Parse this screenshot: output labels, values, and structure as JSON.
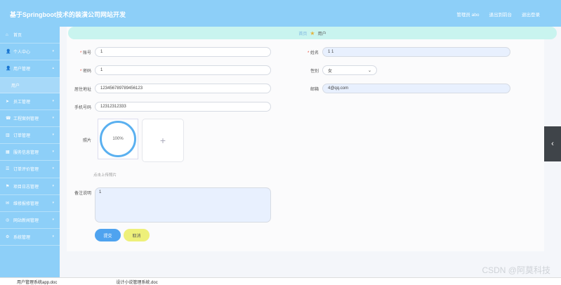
{
  "header": {
    "title": "基于Springboot技术的装潢公司网站开发",
    "links": [
      "管理员 abo",
      "退出到前台",
      "退出登录"
    ]
  },
  "sidebar": {
    "items": [
      {
        "label": "首页",
        "icon": "home-icon",
        "glyph": "⌂"
      },
      {
        "label": "个人中心",
        "icon": "user-icon",
        "glyph": "👤"
      },
      {
        "label": "用户管理",
        "icon": "user-icon",
        "glyph": "👤"
      },
      {
        "label": "员工管理",
        "icon": "send-icon",
        "glyph": "➤"
      },
      {
        "label": "工程案例管理",
        "icon": "phone-icon",
        "glyph": "☎"
      },
      {
        "label": "订单管理",
        "icon": "chart-icon",
        "glyph": "▥"
      },
      {
        "label": "服务信息管理",
        "icon": "grid-icon",
        "glyph": "▦"
      },
      {
        "label": "订单评价管理",
        "icon": "list-icon",
        "glyph": "☰"
      },
      {
        "label": "项目日志管理",
        "icon": "flag-icon",
        "glyph": "⚑"
      },
      {
        "label": "维修报修管理",
        "icon": "chat-icon",
        "glyph": "✉"
      },
      {
        "label": "网站新闻管理",
        "icon": "circle-icon",
        "glyph": "◎"
      },
      {
        "label": "系统管理",
        "icon": "gear-icon",
        "glyph": "⚙"
      }
    ],
    "submenu_item": "用户"
  },
  "breadcrumb": {
    "home": "首页",
    "current": "用户"
  },
  "form": {
    "account_label": "账号",
    "account_value": "1",
    "name_label": "姓名",
    "name_value": "1 1",
    "password_label": "密码",
    "password_value": "1",
    "gender_label": "性别",
    "gender_value": "女",
    "address_label": "居住地址",
    "address_value": "12345678978945612​3",
    "email_label": "邮箱",
    "email_value": "4@qq.com",
    "phone_label": "手机号码",
    "phone_value": "12312312333",
    "photo_label": "照片",
    "photo_progress_text": "100%",
    "upload_hint": "点击上传照片",
    "remark_label": "备注说明",
    "remark_value": "1",
    "submit_label": "提交",
    "cancel_label": "取消"
  },
  "taskbar": {
    "items": [
      "用户管理系统app.doc",
      "设计小说管理系统.doc"
    ]
  },
  "watermark": "CSDN @阿莫科技",
  "colors": {
    "header": "#8dcff8",
    "breadcrumb_bg": "#c9f4ef",
    "submit": "#4fa3ef",
    "cancel": "#eef07a"
  }
}
